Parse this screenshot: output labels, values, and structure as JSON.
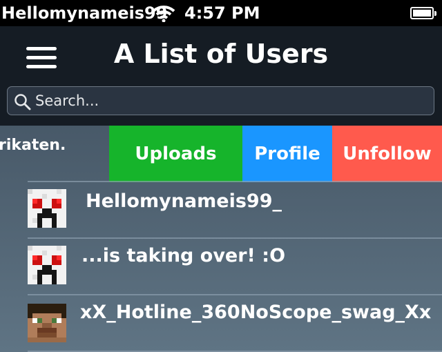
{
  "status_bar": {
    "carrier": "Hellomynameis99",
    "time": "4:57 PM"
  },
  "nav": {
    "title": "A List of Users"
  },
  "search": {
    "placeholder": "Search..."
  },
  "swiped_row": {
    "name_fragment": "rikaten.",
    "actions": {
      "uploads": "Uploads",
      "profile": "Profile",
      "unfollow": "Unfollow"
    },
    "colors": {
      "uploads": "#16b42b",
      "profile": "#1a96ff",
      "unfollow": "#ff5a4d"
    }
  },
  "users": [
    {
      "name": "Hellomynameis99_",
      "avatar": "creeper-avatar-icon"
    },
    {
      "name": "...is taking over! :O",
      "avatar": "creeper-avatar-icon"
    },
    {
      "name": "xX_Hotline_360NoScope_swag_Xx",
      "avatar": "steve-avatar-icon"
    }
  ]
}
